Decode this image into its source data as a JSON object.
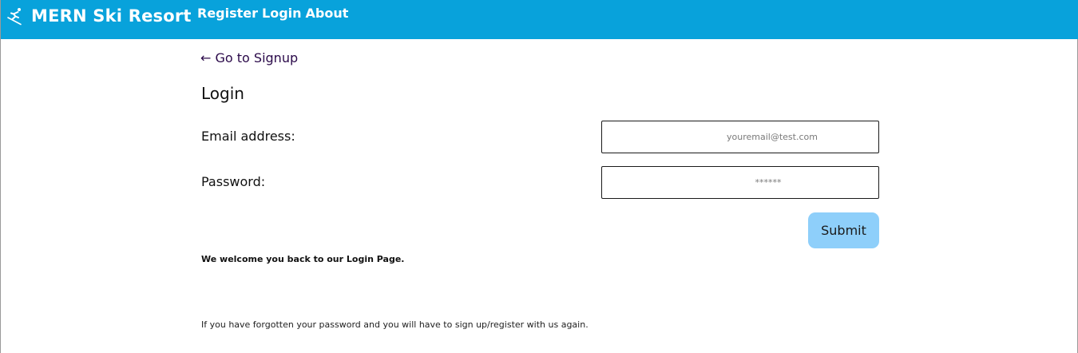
{
  "navbar": {
    "brand_icon": "skier-icon",
    "brand": "MERN Ski Resort",
    "links": [
      "Register",
      "Login",
      "About"
    ]
  },
  "back_link": {
    "arrow": "←",
    "label": "Go to Signup"
  },
  "page_title": "Login",
  "form": {
    "email": {
      "label": "Email address:",
      "placeholder": "youremail@test.com",
      "value": ""
    },
    "password": {
      "label": "Password:",
      "placeholder": "******",
      "value": ""
    },
    "submit_label": "Submit"
  },
  "welcome_text": "We welcome you back to our Login Page.",
  "forgot_text": "If you have forgotten your password and you will have to sign up/register with us again.",
  "colors": {
    "navbar_bg": "#08a2db",
    "submit_bg": "#8ecffa",
    "back_link": "#2b0a4a"
  }
}
